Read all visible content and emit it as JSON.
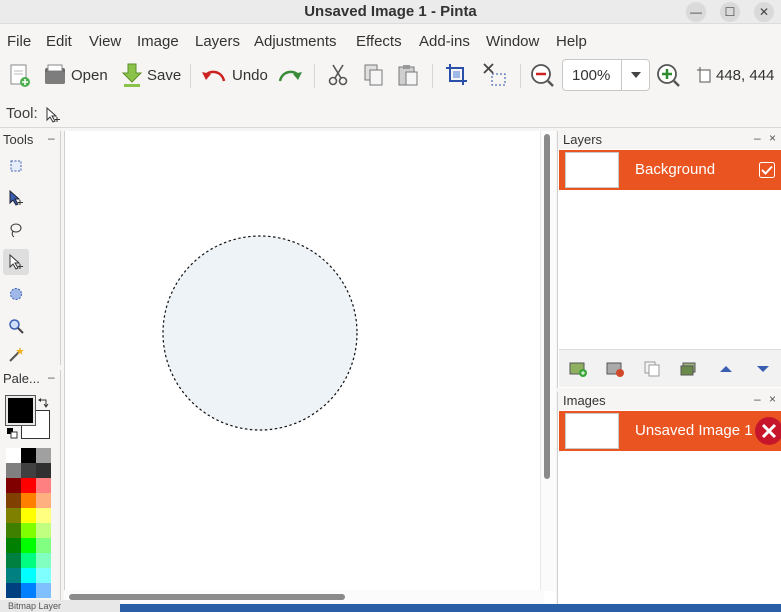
{
  "window": {
    "title": "Unsaved Image 1 - Pinta",
    "minimize_glyph": "—",
    "maximize_glyph": "☐",
    "close_glyph": "✕"
  },
  "menu": [
    "File",
    "Edit",
    "View",
    "Image",
    "Layers",
    "Adjustments",
    "Effects",
    "Add-ins",
    "Window",
    "Help"
  ],
  "toolbar": {
    "open_label": "Open",
    "save_label": "Save",
    "undo_label": "Undo",
    "zoom_value": "100%",
    "cursor_position": "448, 444"
  },
  "toolrow": {
    "label": "Tool:"
  },
  "tools_panel": {
    "title": "Tools",
    "collapse": "–"
  },
  "palette_panel": {
    "title": "Pale...",
    "collapse": "–"
  },
  "palette": {
    "primary_color": "#000000",
    "secondary_color": "#ffffff",
    "swatches": [
      "#ffffff",
      "#000000",
      "#a0a0a0",
      "#808080",
      "#404040",
      "#303030",
      "#800000",
      "#ff0000",
      "#ff8080",
      "#804000",
      "#ff8000",
      "#ffb080",
      "#808000",
      "#ffff00",
      "#ffff80",
      "#408000",
      "#80ff00",
      "#c0ff80",
      "#008000",
      "#00ff00",
      "#80ff80",
      "#008040",
      "#00ff80",
      "#80ffc0",
      "#008080",
      "#00ffff",
      "#80ffff",
      "#004080",
      "#0080ff",
      "#80c0ff"
    ]
  },
  "layers_panel": {
    "title": "Layers",
    "collapse": "–",
    "close": "×",
    "layers": [
      {
        "name": "Background",
        "visible": true
      }
    ]
  },
  "images_panel": {
    "title": "Images",
    "collapse": "–",
    "close": "×",
    "images": [
      {
        "name": "Unsaved Image 1"
      }
    ]
  },
  "status": {
    "layer_label": "Bitmap Layer"
  },
  "colors": {
    "accent": "#e95420",
    "selection_fill": "#eef3f8",
    "status_strip": "#2a5fa8"
  },
  "icons": {
    "new": "new-image-icon",
    "open": "open-icon",
    "save": "save-icon",
    "undo": "undo-icon",
    "redo": "redo-icon",
    "cut": "cut-icon",
    "copy": "copy-icon",
    "paste": "paste-icon",
    "crop": "crop-icon",
    "deselect": "deselect-icon",
    "zoom_out": "zoom-out-icon",
    "zoom_in": "zoom-in-icon",
    "image_size": "image-size-icon"
  }
}
